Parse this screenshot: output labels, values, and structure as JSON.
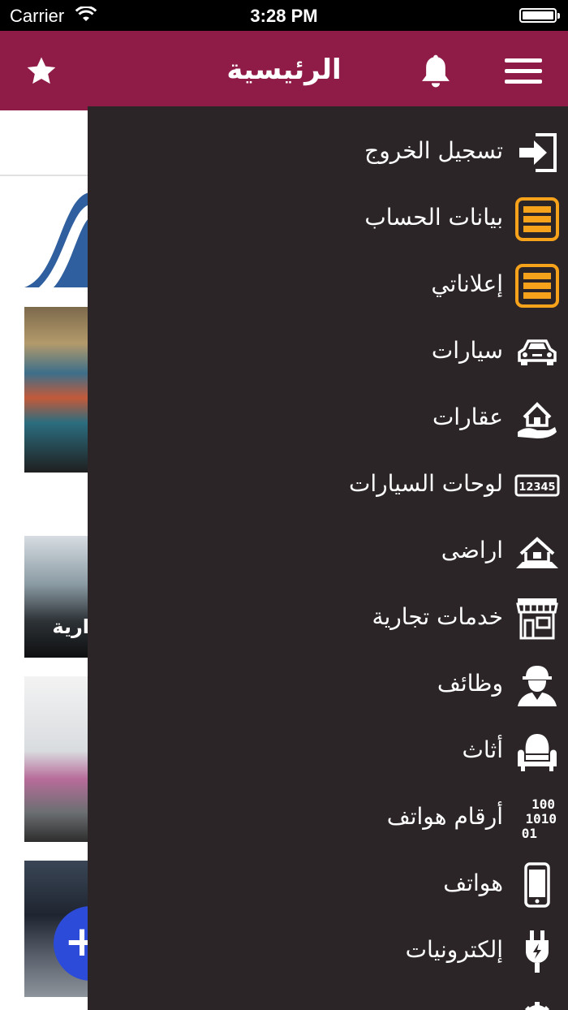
{
  "status_bar": {
    "carrier": "Carrier",
    "time": "3:28 PM"
  },
  "header": {
    "title": "الرئيسية"
  },
  "background": {
    "thumb_label": "ارية"
  },
  "colors": {
    "header": "#8f1b47",
    "drawer": "#2b2527",
    "accent_orange": "#f7a21b",
    "fab": "#2c4bd9"
  },
  "drawer": {
    "items": [
      {
        "label": "تسجيل الخروج",
        "icon": "logout-icon"
      },
      {
        "label": "بيانات الحساب",
        "icon": "account-data-icon"
      },
      {
        "label": "إعلاناتي",
        "icon": "my-ads-icon"
      },
      {
        "label": "سيارات",
        "icon": "car-icon"
      },
      {
        "label": "عقارات",
        "icon": "real-estate-icon"
      },
      {
        "label": "لوحات السيارات",
        "icon": "license-plate-icon"
      },
      {
        "label": "اراضى",
        "icon": "land-icon"
      },
      {
        "label": "خدمات تجارية",
        "icon": "store-icon"
      },
      {
        "label": "وظائف",
        "icon": "worker-icon"
      },
      {
        "label": "أثاث",
        "icon": "armchair-icon"
      },
      {
        "label": "أرقام هواتف",
        "icon": "binary-numbers-icon"
      },
      {
        "label": "هواتف",
        "icon": "mobile-phone-icon"
      },
      {
        "label": "إلكترونيات",
        "icon": "plug-icon"
      },
      {
        "label": "",
        "icon": "settings-icon"
      }
    ]
  }
}
